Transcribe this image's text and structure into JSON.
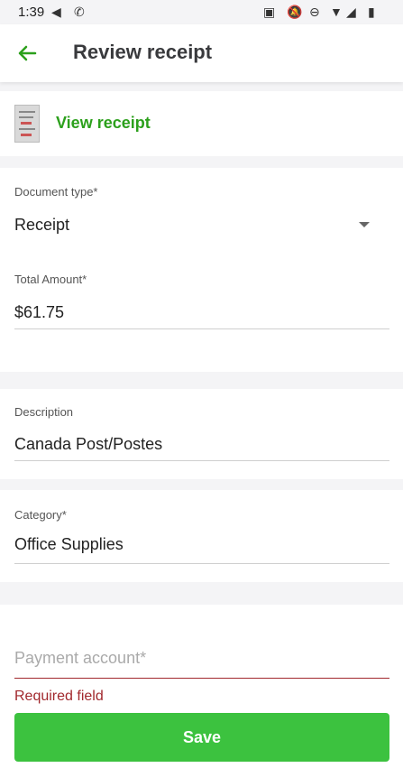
{
  "status_bar": {
    "time": "1:39",
    "icons": [
      "send-icon",
      "call-forward-icon",
      "cast-icon",
      "mute-icon",
      "dnd-icon",
      "wifi-icon",
      "signal-icon",
      "battery-icon"
    ]
  },
  "header": {
    "back_icon": "arrow-left-icon",
    "title": "Review receipt"
  },
  "receipt": {
    "thumbnail": "receipt-thumbnail",
    "view_label": "View receipt"
  },
  "form": {
    "document_type": {
      "label": "Document type*",
      "value": "Receipt"
    },
    "total_amount": {
      "label": "Total Amount*",
      "value": "$61.75"
    },
    "description": {
      "label": "Description",
      "value": "Canada Post/Postes"
    },
    "category": {
      "label": "Category*",
      "value": "Office Supplies"
    },
    "payment_account": {
      "placeholder": "Payment account*",
      "error": "Required field"
    }
  },
  "actions": {
    "save_label": "Save"
  },
  "colors": {
    "accent_green": "#2ca01c",
    "button_green": "#3cc23f",
    "error_red": "#a1282d",
    "background": "#f4f4f6"
  }
}
